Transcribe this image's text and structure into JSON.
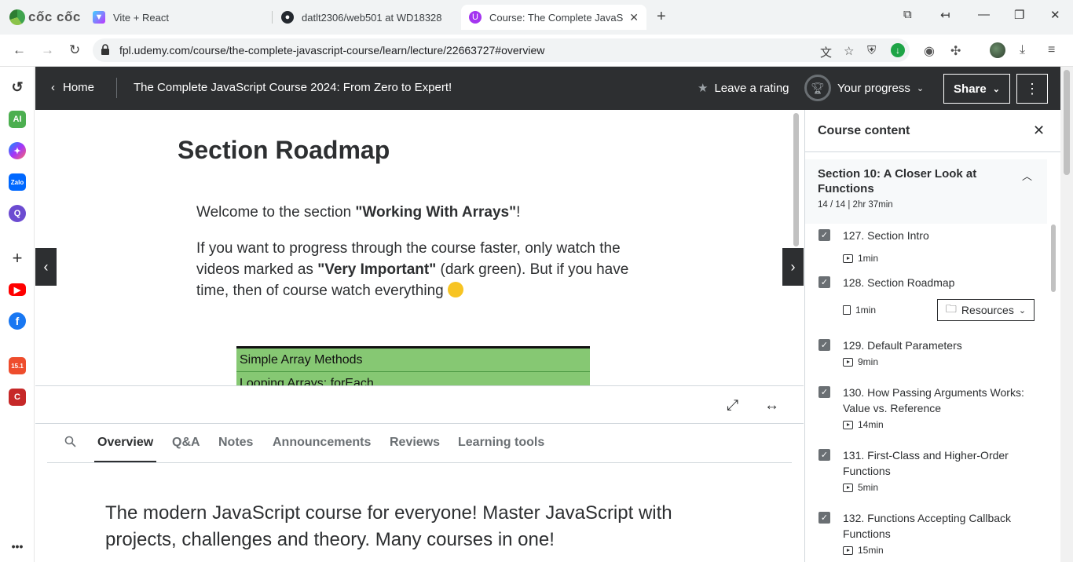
{
  "browser": {
    "brand": "cốc cốc",
    "tabs": [
      {
        "title": "Vite + React",
        "favicon": "vite-icon"
      },
      {
        "title": "datlt2306/web501 at WD18328",
        "favicon": "github-icon"
      },
      {
        "title": "Course: The Complete JavaScrip",
        "favicon": "udemy-icon",
        "active": true
      }
    ],
    "url": "fpl.udemy.com/course/the-complete-javascript-course/learn/lecture/22663727#overview"
  },
  "sidebar": {
    "items": [
      {
        "icon": "history-icon"
      },
      {
        "icon": "ai-icon",
        "label": "AI"
      },
      {
        "icon": "messenger-icon"
      },
      {
        "icon": "zalo-icon",
        "label": "Zalo"
      },
      {
        "icon": "q-icon",
        "label": "Q"
      },
      {
        "icon": "add-icon"
      },
      {
        "icon": "youtube-icon"
      },
      {
        "icon": "facebook-icon"
      },
      {
        "icon": "shopee-icon",
        "label": "15.1"
      },
      {
        "icon": "game-icon"
      },
      {
        "icon": "more-icon"
      }
    ]
  },
  "header": {
    "home": "Home",
    "course_title": "The Complete JavaScript Course 2024: From Zero to Expert!",
    "rating": "Leave a rating",
    "progress": "Your progress",
    "share": "Share"
  },
  "lecture": {
    "title": "Section Roadmap",
    "p1_pre": "Welcome to the section ",
    "p1_bold": "\"Working With Arrays\"",
    "p1_post": "!",
    "p2_pre": "If you want to progress through the course faster, only watch the videos marked as ",
    "p2_bold": "\"Very Important\"",
    "p2_post": " (dark green). But if you have time, then of course watch everything ",
    "table_rows": [
      "Simple Array Methods",
      "Looping Arrays: forEach"
    ]
  },
  "tabs": {
    "items": [
      "Overview",
      "Q&A",
      "Notes",
      "Announcements",
      "Reviews",
      "Learning tools"
    ],
    "active": "Overview"
  },
  "overview": {
    "headline": "The modern JavaScript course for everyone! Master JavaScript with projects, challenges and theory. Many courses in one!"
  },
  "panel": {
    "title": "Course content",
    "section_title": "Section 10: A Closer Look at Functions",
    "section_meta": "14 / 14 | 2hr 37min",
    "resources": "Resources",
    "items": [
      {
        "title": "127. Section Intro",
        "duration": "1min",
        "kind": "video"
      },
      {
        "title": "128. Section Roadmap",
        "duration": "1min",
        "kind": "doc"
      },
      {
        "title": "129. Default Parameters",
        "duration": "9min",
        "kind": "video"
      },
      {
        "title": "130. How Passing Arguments Works: Value vs. Reference",
        "duration": "14min",
        "kind": "video"
      },
      {
        "title": "131. First-Class and Higher-Order Functions",
        "duration": "5min",
        "kind": "video"
      },
      {
        "title": "132. Functions Accepting Callback Functions",
        "duration": "15min",
        "kind": "video"
      }
    ]
  },
  "colors": {
    "header_bg": "#2d2f31",
    "table_green": "#86c873",
    "checkbox": "#6a6f73"
  }
}
